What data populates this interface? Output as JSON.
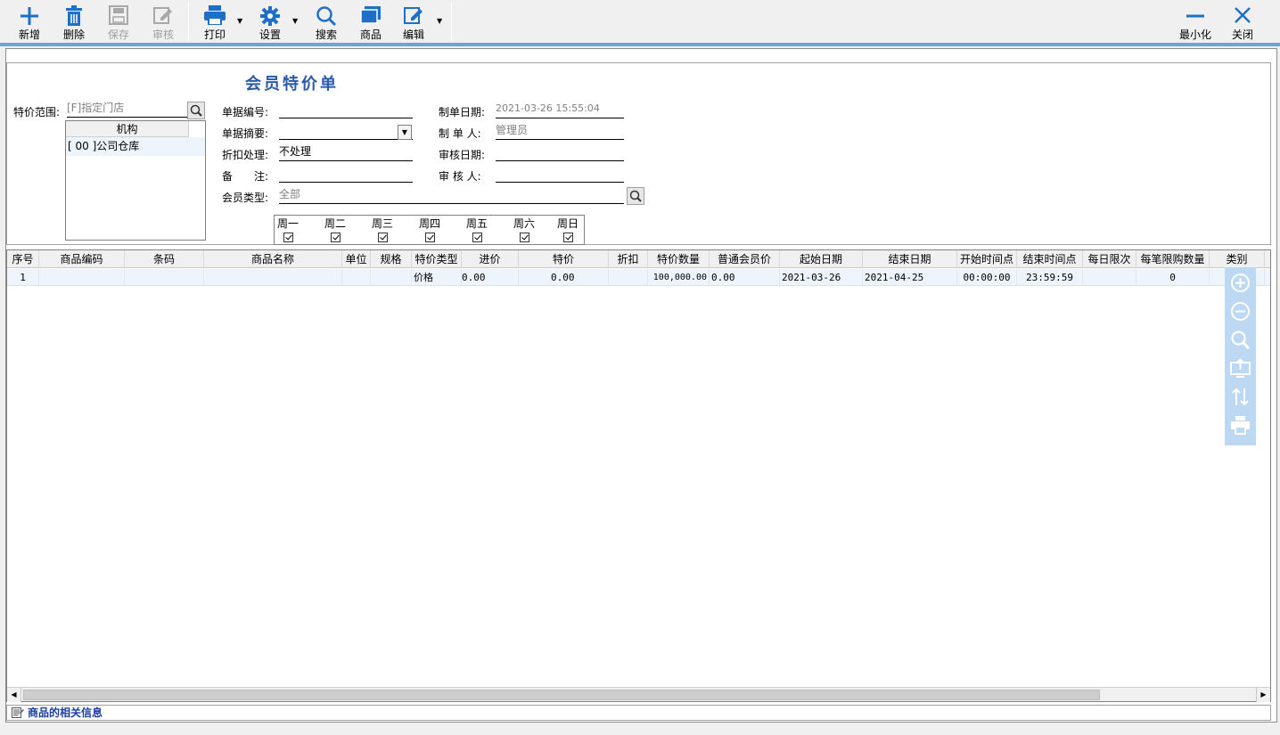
{
  "toolbar": {
    "add": "新增",
    "delete": "删除",
    "save": "保存",
    "audit": "审核",
    "print": "打印",
    "settings": "设置",
    "search": "搜索",
    "goods": "商品",
    "edit": "编辑",
    "minimize": "最小化",
    "close": "关闭"
  },
  "form": {
    "title": "会员特价单",
    "scope_label": "特价范围:",
    "scope_value": "[F]指定门店",
    "org_header": "机构",
    "org_rows": [
      "[ 00 ]公司仓库"
    ],
    "doc_no_label": "单据编号:",
    "doc_no_value": "",
    "summary_label": "单据摘要:",
    "summary_value": "",
    "discount_label": "折扣处理:",
    "discount_value": "不处理",
    "remark_label": "备　　注:",
    "remark_value": "",
    "member_type_label": "会员类型:",
    "member_type_value": "全部",
    "create_date_label": "制单日期:",
    "create_date_value": "2021-03-26 15:55:04",
    "creator_label": "制 单 人:",
    "creator_value": "管理员",
    "audit_date_label": "审核日期:",
    "audit_date_value": "",
    "auditor_label": "审 核 人:",
    "auditor_value": ""
  },
  "weekdays": [
    {
      "name": "周一",
      "checked": true
    },
    {
      "name": "周二",
      "checked": true
    },
    {
      "name": "周三",
      "checked": true
    },
    {
      "name": "周四",
      "checked": true
    },
    {
      "name": "周五",
      "checked": true
    },
    {
      "name": "周六",
      "checked": true
    },
    {
      "name": "周日",
      "checked": true
    }
  ],
  "grid": {
    "columns": [
      "序号",
      "商品编码",
      "条码",
      "商品名称",
      "单位",
      "规格",
      "特价类型",
      "进价",
      "特价",
      "折扣",
      "特价数量",
      "普通会员价",
      "起始日期",
      "结束日期",
      "开始时间点",
      "结束时间点",
      "每日限次",
      "每笔限购数量",
      "类别"
    ],
    "rows": [
      [
        "1",
        "",
        "",
        "",
        "",
        "",
        "价格",
        "0.00",
        "0.00",
        "",
        "100,000.00",
        "0.00",
        "2021-03-26",
        "2021-04-25",
        "00:00:00",
        "23:59:59",
        "",
        "0",
        ""
      ]
    ]
  },
  "footer": {
    "info": "商品的相关信息"
  },
  "colors": {
    "accent": "#1e6fc8",
    "title": "#2a5aa8",
    "row_bg": "#eef4fb",
    "side_tools": "#bcd8f3"
  }
}
